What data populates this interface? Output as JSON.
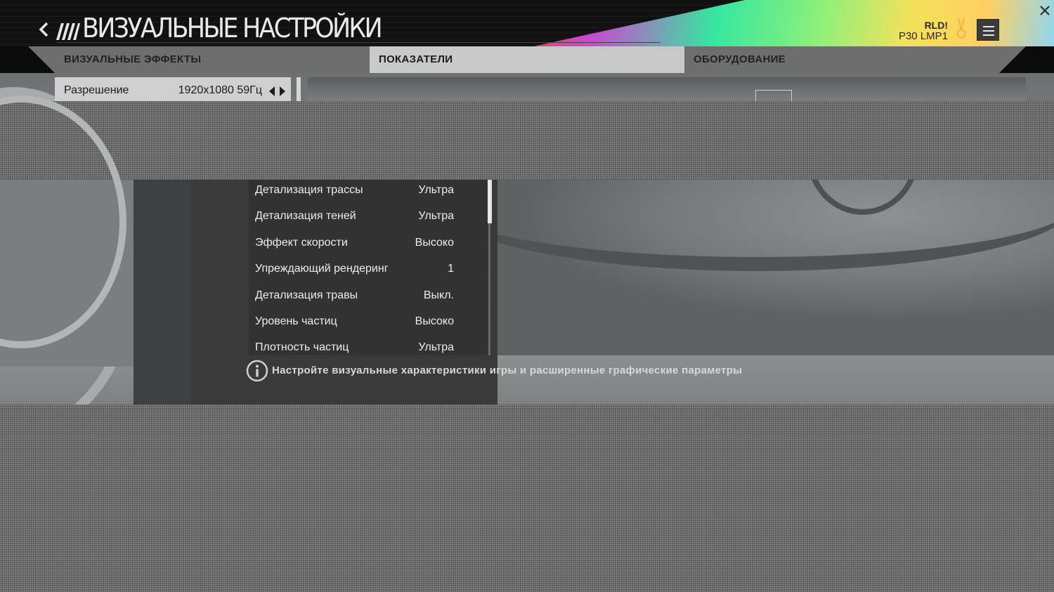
{
  "header": {
    "title": "ВИЗУАЛЬНЫЕ НАСТРОЙКИ",
    "profile_name": "RLD!",
    "profile_car": "P30 LMP1"
  },
  "tabs": [
    {
      "label": "ВИЗУАЛЬНЫЕ ЭФФЕКТЫ"
    },
    {
      "label": "ПОКАЗАТЕЛИ"
    },
    {
      "label": "ОБОРУДОВАНИЕ"
    }
  ],
  "resolution": {
    "label": "Разрешение",
    "value": "1920x1080 59Гц"
  },
  "settings": [
    {
      "label": "Детализация трассы",
      "value": "Ультра"
    },
    {
      "label": "Детализация теней",
      "value": "Ультра"
    },
    {
      "label": "Эффект скорости",
      "value": "Высоко"
    },
    {
      "label": "Упреждающий рендеринг",
      "value": "1"
    },
    {
      "label": "Детализация травы",
      "value": "Выкл."
    },
    {
      "label": "Уровень частиц",
      "value": "Высоко"
    },
    {
      "label": "Плотность частиц",
      "value": "Ультра"
    }
  ],
  "info_text": "Настройте визуальные характеристики игры и расширенные графические параметры",
  "colors": {
    "active_tab": "#c9c9c9",
    "tab_bar": "#6e6e6e",
    "resolution_row": "#cfcfcf",
    "scroll_thumb": "#e6e6e6"
  },
  "icons": [
    "back-icon",
    "logo-icon",
    "medal-icon",
    "menu-icon",
    "close-icon",
    "arrow-left-icon",
    "arrow-right-icon",
    "info-icon"
  ]
}
